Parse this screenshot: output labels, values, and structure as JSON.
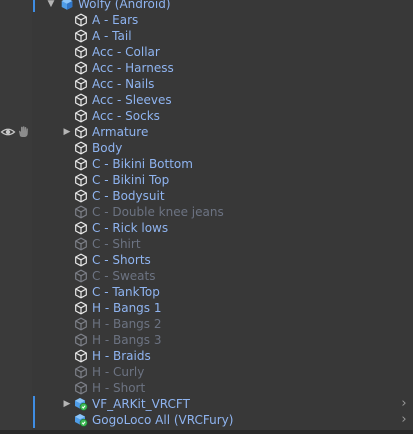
{
  "hierarchy": {
    "root": {
      "label": "Wolfy (Android)"
    },
    "children": [
      {
        "label": "A -  Ears",
        "state": "active"
      },
      {
        "label": "A - Tail",
        "state": "active"
      },
      {
        "label": "Acc - Collar",
        "state": "active"
      },
      {
        "label": "Acc - Harness",
        "state": "active"
      },
      {
        "label": "Acc - Nails",
        "state": "active"
      },
      {
        "label": "Acc - Sleeves",
        "state": "active"
      },
      {
        "label": "Acc - Socks",
        "state": "active"
      },
      {
        "label": "Armature",
        "state": "active"
      },
      {
        "label": "Body",
        "state": "active"
      },
      {
        "label": "C - Bikini Bottom",
        "state": "active"
      },
      {
        "label": "C - Bikini Top",
        "state": "active"
      },
      {
        "label": "C - Bodysuit",
        "state": "active"
      },
      {
        "label": "C - Double knee jeans",
        "state": "disabled"
      },
      {
        "label": "C - Rick lows",
        "state": "active"
      },
      {
        "label": "C - Shirt",
        "state": "disabled"
      },
      {
        "label": "C - Shorts",
        "state": "active"
      },
      {
        "label": "C - Sweats",
        "state": "disabled"
      },
      {
        "label": "C - TankTop",
        "state": "active"
      },
      {
        "label": "H - Bangs 1",
        "state": "active"
      },
      {
        "label": "H - Bangs 2",
        "state": "disabled"
      },
      {
        "label": "H - Bangs 3",
        "state": "disabled"
      },
      {
        "label": "H - Braids",
        "state": "active"
      },
      {
        "label": "H - Curly",
        "state": "disabled"
      },
      {
        "label": "H - Short",
        "state": "disabled"
      }
    ],
    "siblings": [
      {
        "label": "VF_ARKit_VRCFT"
      },
      {
        "label": "GogoLoco All (VRCFury)"
      }
    ]
  },
  "icons": {
    "cube": "cube-icon",
    "prefab": "prefab-icon",
    "vrcfury_prefab": "vrcfury-prefab-icon",
    "visibility": "eye-icon",
    "pickable": "hand-icon",
    "expand_open": "triangle-down-icon",
    "expand_closed": "triangle-right-icon",
    "chevron": "chevron-right-icon"
  },
  "colors": {
    "background": "#383838",
    "text": "#c6c6c6",
    "active_text": "#8fb4f0",
    "disabled_text": "#6c7382",
    "marker": "#3f8de3",
    "prefab_blue": "#5aa7f0",
    "vrcfury_green": "#3cba54"
  }
}
